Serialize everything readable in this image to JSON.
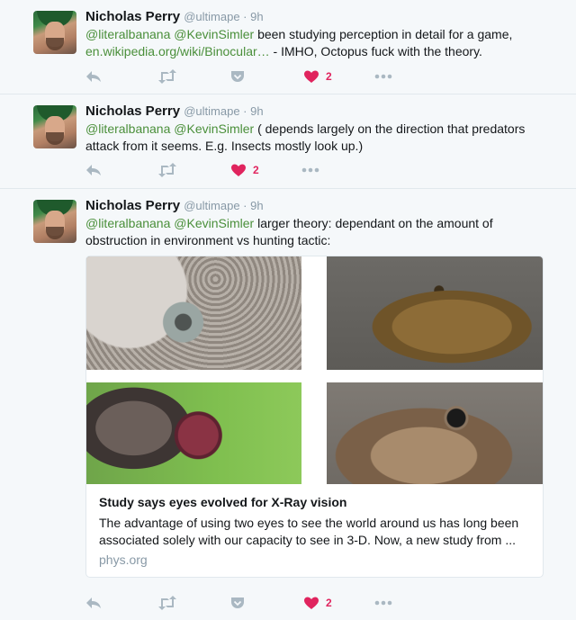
{
  "colors": {
    "background": "#f5f8fa",
    "mention": "#4a8f3a",
    "like": "#e0245e",
    "muted": "#8899a6"
  },
  "tweets": [
    {
      "name": "Nicholas Perry",
      "handle": "@ultimape · 9h",
      "mention1": "@literalbanana",
      "mention2": "@KevinSimler",
      "text_a": " been studying perception in detail for a game,",
      "link": "en.wikipedia.org/wiki/Binocular…",
      "text_b": " - IMHO, Octopus fuck with the theory.",
      "likes": "2"
    },
    {
      "name": "Nicholas Perry",
      "handle": "@ultimape · 9h",
      "mention1": "@literalbanana",
      "mention2": "@KevinSimler",
      "text_a": " ( depends largely on the direction that predators attack from it seems. E.g. Insects mostly look up.)",
      "likes": "2"
    },
    {
      "name": "Nicholas Perry",
      "handle": "@ultimape · 9h",
      "mention1": "@literalbanana",
      "mention2": "@KevinSimler",
      "text_a": " larger theory: dependant on the amount of obstruction in environment vs hunting tactic:",
      "likes": "2",
      "card": {
        "title": "Study says eyes evolved for X-Ray vision",
        "description": "The advantage of using two eyes to see the world around us has long been associated solely with our capacity to see in 3-D. Now, a new study from ...",
        "domain": "phys.org",
        "images": [
          "octopus eye",
          "dinosaur head",
          "fly eyes",
          "lizard eye"
        ]
      }
    }
  ],
  "icons": [
    "reply-icon",
    "retweet-icon",
    "pocket-icon",
    "heart-icon",
    "more-icon"
  ]
}
